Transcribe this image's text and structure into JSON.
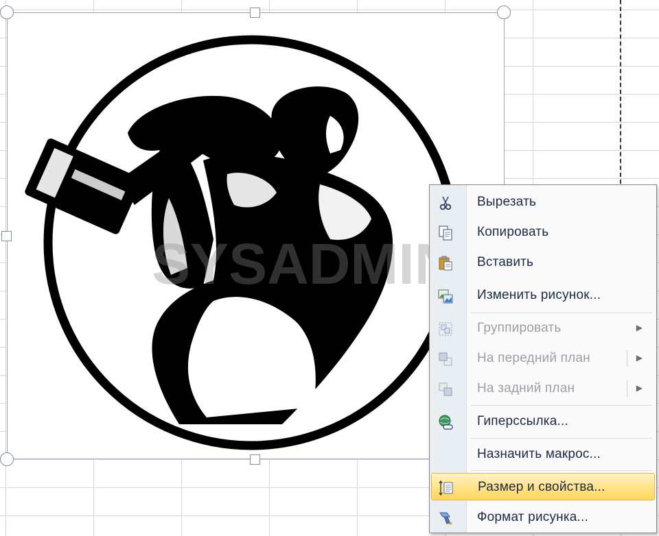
{
  "context_menu": {
    "items": [
      {
        "label": "Вырезать",
        "icon": "scissors-icon",
        "enabled": true
      },
      {
        "label": "Копировать",
        "icon": "copy-icon",
        "enabled": true
      },
      {
        "label": "Вставить",
        "icon": "paste-icon",
        "enabled": true
      },
      {
        "label": "Изменить рисунок...",
        "icon": "change-picture-icon",
        "enabled": true
      },
      {
        "label": "Группировать",
        "icon": "group-icon",
        "enabled": false,
        "submenu": true
      },
      {
        "label": "На передний план",
        "icon": "bring-to-front-icon",
        "enabled": false,
        "submenu": true
      },
      {
        "label": "На задний план",
        "icon": "send-to-back-icon",
        "enabled": false,
        "submenu": true
      },
      {
        "label": "Гиперссылка...",
        "icon": "hyperlink-icon",
        "enabled": true
      },
      {
        "label": "Назначить макрос...",
        "icon": "",
        "enabled": true
      },
      {
        "label": "Размер и свойства...",
        "icon": "size-properties-icon",
        "enabled": true,
        "highlighted": true
      },
      {
        "label": "Формат рисунка...",
        "icon": "format-picture-icon",
        "enabled": true
      }
    ],
    "colors": {
      "highlight": "#ffd65a",
      "text": "#1b2a44",
      "disabled_text": "#9a9fa8"
    }
  },
  "picture": {
    "watermark": "SYSADMIN.RU"
  }
}
